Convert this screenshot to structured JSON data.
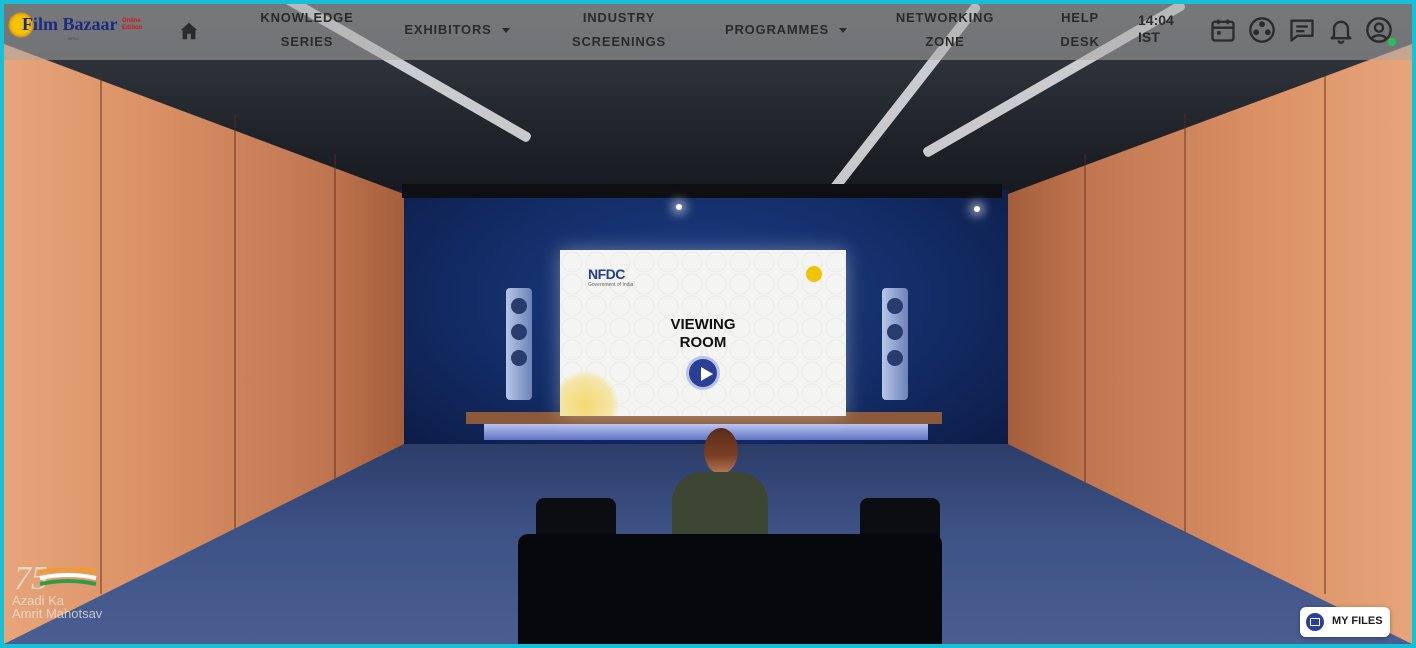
{
  "brand": {
    "logo_text": "Film Bazaar",
    "logo_sub": "Online Edition",
    "logo_tag": "NFDC"
  },
  "nav": {
    "home_icon": "home-icon",
    "items": [
      {
        "label_line1": "KNOWLEDGE",
        "label_line2": "SERIES",
        "dropdown": false
      },
      {
        "label_line1": "EXHIBITORS",
        "label_line2": "",
        "dropdown": true
      },
      {
        "label_line1": "INDUSTRY",
        "label_line2": "SCREENINGS",
        "dropdown": false
      },
      {
        "label_line1": "PROGRAMMES",
        "label_line2": "",
        "dropdown": true
      },
      {
        "label_line1": "NETWORKING",
        "label_line2": "ZONE",
        "dropdown": false
      },
      {
        "label_line1": "HELP",
        "label_line2": "DESK",
        "dropdown": false
      }
    ],
    "clock_time": "14:04",
    "clock_zone": "IST",
    "icons": [
      "calendar-icon",
      "film-reel-icon",
      "chat-icon",
      "bell-icon",
      "user-profile-icon"
    ],
    "online_status_color": "#23c552"
  },
  "scene": {
    "screen_brand": "NFDC",
    "screen_brand_sub": "Government of India",
    "screen_title_line1": "VIEWING",
    "screen_title_line2": "ROOM",
    "play_icon": "play-icon"
  },
  "footer": {
    "azadi_number": "75",
    "azadi_line1": "Azadi Ka",
    "azadi_line2": "Amrit Mahotsav",
    "my_files_label": "MY FILES",
    "my_files_icon": "folder-icon"
  },
  "colors": {
    "frame_border": "#16c0d6",
    "accent_blue": "#2a3f96",
    "nav_text": "#2b2b2b"
  }
}
